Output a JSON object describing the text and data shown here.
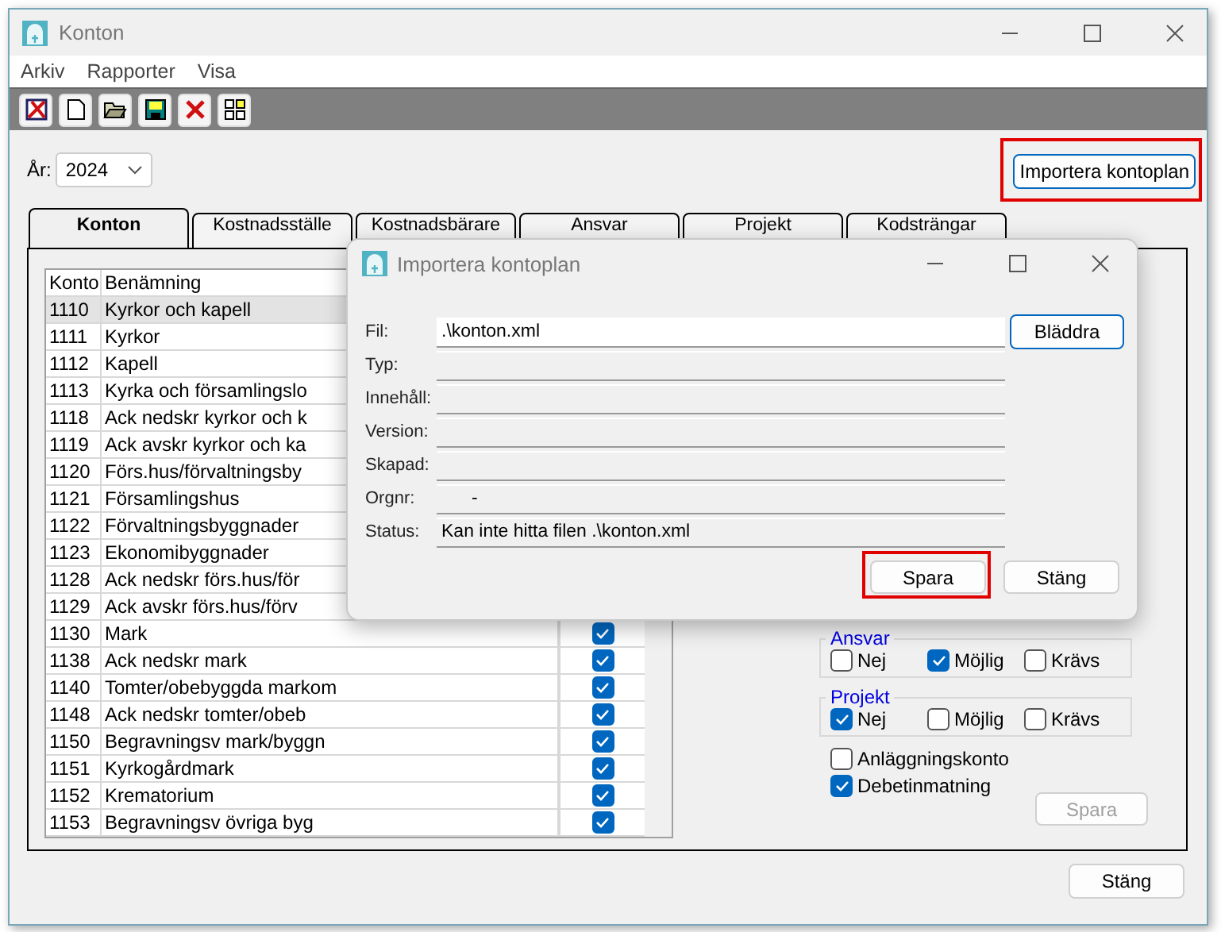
{
  "window": {
    "title": "Konton"
  },
  "menu": [
    "Arkiv",
    "Rapporter",
    "Visa"
  ],
  "toolbar": [
    {
      "kind": "exit"
    },
    {
      "kind": "new"
    },
    {
      "kind": "open"
    },
    {
      "kind": "save"
    },
    {
      "kind": "delete"
    },
    {
      "kind": "grid"
    }
  ],
  "year": {
    "label": "År:",
    "value": "2024"
  },
  "import_button": {
    "label": "Importera kontoplan",
    "highlighted": true
  },
  "tabs": [
    {
      "label": "Konton",
      "selected": true
    },
    {
      "label": "Kostnadsställe",
      "selected": false
    },
    {
      "label": "Kostnadsbärare",
      "selected": false
    },
    {
      "label": "Ansvar",
      "selected": false
    },
    {
      "label": "Projekt",
      "selected": false
    },
    {
      "label": "Kodsträngar",
      "selected": false
    }
  ],
  "table": {
    "columns": [
      "Konto",
      "Benämning"
    ],
    "rows": [
      {
        "konto": "1110",
        "name": "Kyrkor och kapell",
        "selected": true
      },
      {
        "konto": "1111",
        "name": "Kyrkor",
        "selected": false
      },
      {
        "konto": "1112",
        "name": "Kapell",
        "selected": false
      },
      {
        "konto": "1113",
        "name": "Kyrka och församlingslo",
        "selected": false
      },
      {
        "konto": "1118",
        "name": "Ack nedskr kyrkor och k",
        "selected": false
      },
      {
        "konto": "1119",
        "name": "Ack avskr kyrkor och ka",
        "selected": false
      },
      {
        "konto": "1120",
        "name": "Förs.hus/förvaltningsby",
        "selected": false
      },
      {
        "konto": "1121",
        "name": "Församlingshus",
        "selected": false
      },
      {
        "konto": "1122",
        "name": "Förvaltningsbyggnader",
        "selected": false
      },
      {
        "konto": "1123",
        "name": "Ekonomibyggnader",
        "selected": false
      },
      {
        "konto": "1128",
        "name": "Ack nedskr förs.hus/för",
        "selected": false
      },
      {
        "konto": "1129",
        "name": "Ack avskr förs.hus/förv",
        "selected": false
      },
      {
        "konto": "1130",
        "name": "Mark",
        "selected": false,
        "checked": true
      },
      {
        "konto": "1138",
        "name": "Ack nedskr mark",
        "selected": false,
        "checked": true
      },
      {
        "konto": "1140",
        "name": "Tomter/obebyggda markom",
        "selected": false,
        "checked": true
      },
      {
        "konto": "1148",
        "name": "Ack nedskr tomter/obeb",
        "selected": false,
        "checked": true
      },
      {
        "konto": "1150",
        "name": "Begravningsv mark/byggn",
        "selected": false,
        "checked": true
      },
      {
        "konto": "1151",
        "name": "Kyrkogårdmark",
        "selected": false,
        "checked": true
      },
      {
        "konto": "1152",
        "name": "Krematorium",
        "selected": false,
        "checked": true
      },
      {
        "konto": "1153",
        "name": "Begravningsv övriga byg",
        "selected": false,
        "checked": true
      }
    ]
  },
  "groups": [
    {
      "title": "Ansvar",
      "options": [
        {
          "label": "Nej",
          "checked": false
        },
        {
          "label": "Möjlig",
          "checked": true
        },
        {
          "label": "Krävs",
          "checked": false
        }
      ]
    },
    {
      "title": "Projekt",
      "options": [
        {
          "label": "Nej",
          "checked": true
        },
        {
          "label": "Möjlig",
          "checked": false
        },
        {
          "label": "Krävs",
          "checked": false
        }
      ]
    }
  ],
  "flags": [
    {
      "label": "Anläggningskonto",
      "checked": false
    },
    {
      "label": "Debetinmatning",
      "checked": true
    }
  ],
  "save_button": {
    "label": "Spara",
    "disabled": true
  },
  "close_button": {
    "label": "Stäng"
  },
  "dialog": {
    "title": "Importera kontoplan",
    "fields": [
      {
        "label": "Fil:",
        "value": ".\\konton.xml",
        "editable": true
      },
      {
        "label": "Typ:",
        "editable": false
      },
      {
        "label": "Innehåll:",
        "editable": false
      },
      {
        "label": "Version:",
        "editable": false
      },
      {
        "label": "Skapad:",
        "editable": false
      },
      {
        "label": "Orgnr:",
        "value": "-",
        "editable": false
      },
      {
        "label": "Status:",
        "value": "Kan inte hitta filen .\\konton.xml",
        "editable": false
      }
    ],
    "browse_button": "Bläddra",
    "buttons": [
      {
        "label": "Spara",
        "highlighted": true
      },
      {
        "label": "Stäng",
        "highlighted": false
      }
    ]
  }
}
